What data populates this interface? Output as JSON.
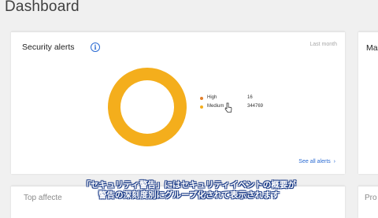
{
  "page": {
    "title": "Dashboard"
  },
  "security_alerts": {
    "title": "Security alerts",
    "period": "Last month",
    "see_all": "See all alerts",
    "legend": [
      {
        "label": "High",
        "value": "16",
        "color": "#e27f2a"
      },
      {
        "label": "Medium",
        "value": "344769",
        "color": "#f4ae1c"
      }
    ]
  },
  "right_card": {
    "title": "Ma"
  },
  "bottom_cards": {
    "left_title": "Top affecte",
    "right_title": "Pro"
  },
  "subtitles": {
    "line1": "「セキュリティ警告」にはセキュリティイベントの概要が",
    "line2": "警告の深刻度別にグループ化されて表示されます"
  },
  "chart_data": {
    "type": "pie",
    "title": "Security alerts",
    "categories": [
      "High",
      "Medium"
    ],
    "values": [
      16,
      344769
    ],
    "colors": [
      "#e27f2a",
      "#f4ae1c"
    ]
  }
}
